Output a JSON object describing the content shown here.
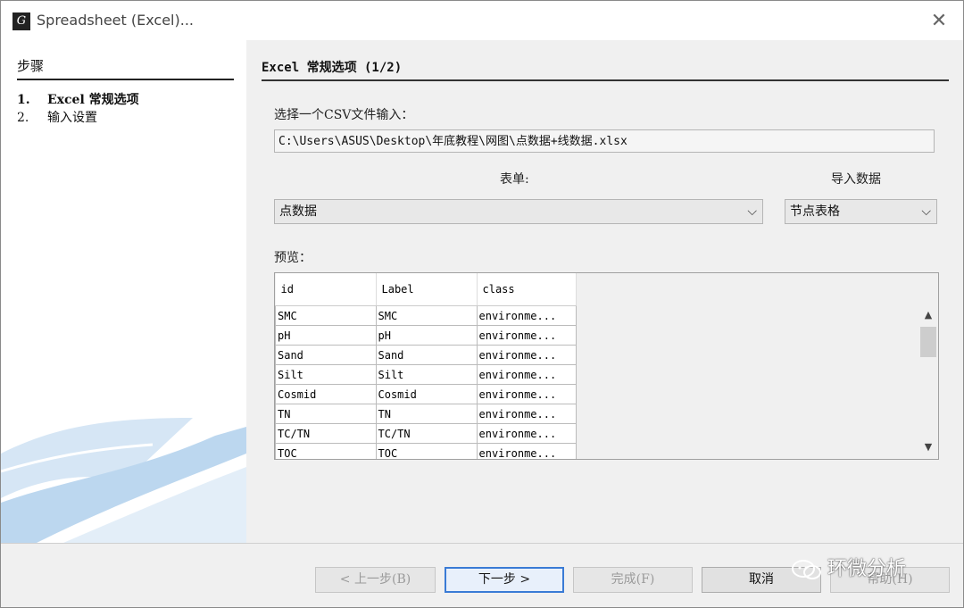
{
  "window": {
    "title": "Spreadsheet (Excel)...",
    "close_glyph": "✕"
  },
  "steps": {
    "heading": "步骤",
    "items": [
      {
        "number": "1.",
        "label": "Excel 常规选项",
        "active": true
      },
      {
        "number": "2.",
        "label": "输入设置",
        "active": false
      }
    ]
  },
  "panel": {
    "title": "Excel 常规选项 (1/2)",
    "file_label": "选择一个CSV文件输入：",
    "file_path": "C:\\Users\\ASUS\\Desktop\\年底教程\\网图\\点数据+线数据.xlsx",
    "sheet_label": "表单:",
    "sheet_value": "点数据",
    "import_label": "导入数据",
    "import_value": "节点表格",
    "preview_label": "预览：",
    "preview": {
      "columns": [
        "id",
        "Label",
        "class"
      ],
      "rows": [
        [
          "SMC",
          "SMC",
          "environme..."
        ],
        [
          "pH",
          "pH",
          "environme..."
        ],
        [
          "Sand",
          "Sand",
          "environme..."
        ],
        [
          "Silt",
          "Silt",
          "environme..."
        ],
        [
          "Cosmid",
          "Cosmid",
          "environme..."
        ],
        [
          "TN",
          "TN",
          "environme..."
        ],
        [
          "TC/TN",
          "TC/TN",
          "environme..."
        ],
        [
          "TOC",
          "TOC",
          "environme..."
        ]
      ]
    }
  },
  "footer": {
    "back_label": "< 上一步(B)",
    "next_label": "下一步 >",
    "finish_label": "完成(F)",
    "cancel_label": "取消",
    "help_label": "帮助(H)"
  },
  "watermark": {
    "text": "环微分析",
    "icon": "wechat-icon"
  },
  "icons": {
    "chevron_down": "⌵",
    "scroll_up": "▲",
    "scroll_down": "▼"
  },
  "colors": {
    "accent": "#3a7bd5",
    "panel_bg": "#f0f0f0",
    "decor_blue": "#bcd7ef"
  }
}
